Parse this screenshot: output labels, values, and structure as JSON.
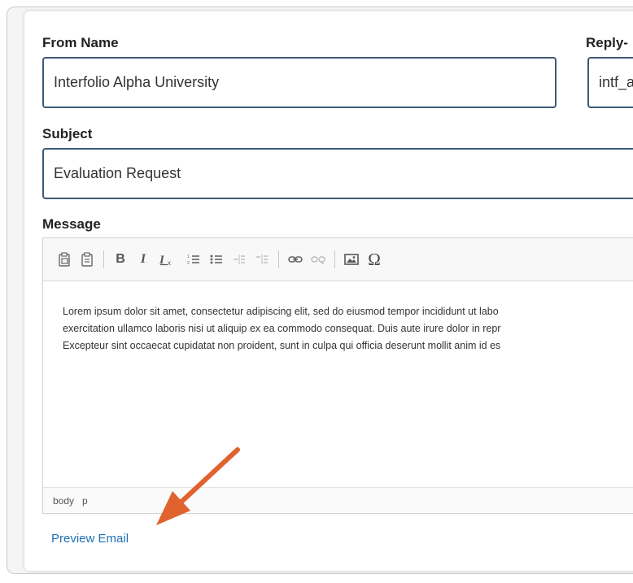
{
  "form": {
    "from_name_label": "From Name",
    "from_name_value": "Interfolio Alpha University",
    "reply_to_label": "Reply-",
    "reply_to_value": "intf_a",
    "subject_label": "Subject",
    "subject_value": "Evaluation Request",
    "message_label": "Message"
  },
  "editor": {
    "toolbar": [
      "paste-icon",
      "paste-text-icon",
      "bold-icon",
      "italic-icon",
      "remove-format-icon",
      "numbered-list-icon",
      "bulleted-list-icon",
      "outdent-icon",
      "indent-icon",
      "link-icon",
      "unlink-icon",
      "image-icon",
      "special-char-icon"
    ],
    "bold_glyph": "B",
    "italic_glyph": "I",
    "omega_glyph": "Ω",
    "lines": [
      "Lorem ipsum dolor sit amet, consectetur adipiscing elit, sed do eiusmod tempor incididunt ut labo",
      "exercitation ullamco laboris nisi ut aliquip ex ea commodo consequat. Duis aute irure dolor in repr",
      "Excepteur sint occaecat cupidatat non proident, sunt in culpa qui officia deserunt mollit anim id es"
    ],
    "status_path": [
      "body",
      "p"
    ]
  },
  "actions": {
    "preview_label": "Preview Email"
  },
  "colors": {
    "field_border": "#3d5a78",
    "link": "#1f6fb5",
    "arrow": "#e0622e"
  }
}
